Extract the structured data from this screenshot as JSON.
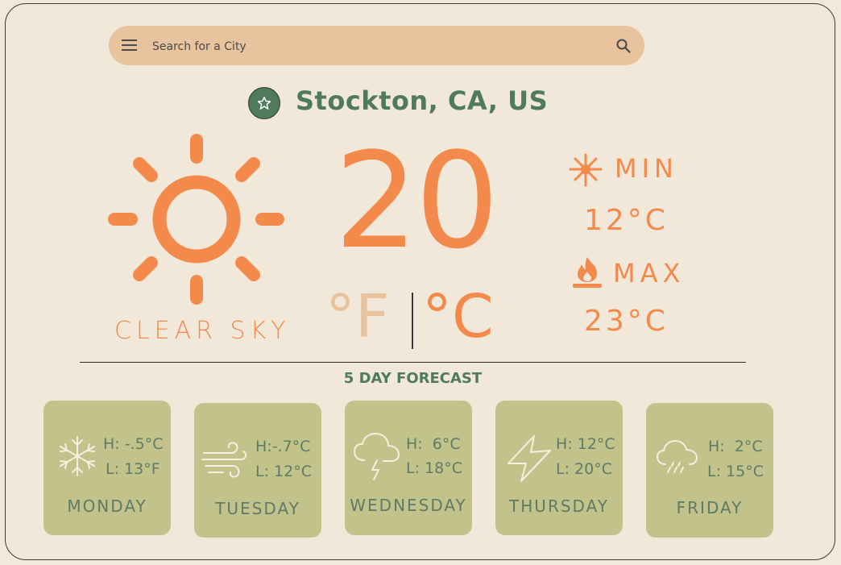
{
  "search": {
    "placeholder": "Search for a City",
    "menu_icon": "menu-icon",
    "search_icon": "search-icon"
  },
  "location": {
    "city": "Stockton, CA, US",
    "favorite_icon": "star-icon"
  },
  "current": {
    "condition": "CLEAR SKY",
    "condition_icon": "sun-icon",
    "temperature": "20",
    "unit_f": "°F",
    "unit_c": "°C",
    "min_label": "MIN",
    "min_value": "12°C",
    "min_icon": "snowflake-sparkle-icon",
    "max_label": "MAX",
    "max_value": "23°C",
    "max_icon": "fire-icon"
  },
  "forecast": {
    "title": "5 DAY FORECAST",
    "days": [
      {
        "day": "MONDAY",
        "high": "H: -.5°C",
        "low": "L: 13°F",
        "icon": "snowflake-icon"
      },
      {
        "day": "TUESDAY",
        "high": "H:-.7°C",
        "low": "L: 12°C",
        "icon": "wind-icon"
      },
      {
        "day": "WEDNESDAY",
        "high": "H:  6°C",
        "low": "L: 18°C",
        "icon": "thunderstorm-icon"
      },
      {
        "day": "THURSDAY",
        "high": "H: 12°C",
        "low": "L: 20°C",
        "icon": "lightning-icon"
      },
      {
        "day": "FRIDAY",
        "high": "H:  2°C",
        "low": "L: 15°C",
        "icon": "rain-cloud-icon"
      }
    ]
  },
  "colors": {
    "background": "#f1e8d9",
    "accent_orange": "#f38a4c",
    "green": "#4f7a5c",
    "search_bg": "#e8c39e",
    "card_bg": "#c2c38b"
  }
}
